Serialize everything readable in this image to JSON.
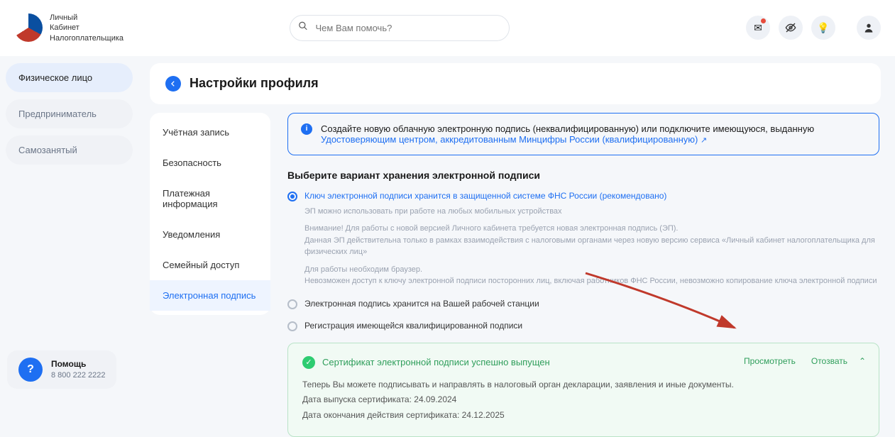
{
  "header": {
    "logo_line1": "Личный",
    "logo_line2": "Кабинет",
    "logo_line3": "Налогоплательщика",
    "search_placeholder": "Чем Вам помочь?"
  },
  "sidebar": {
    "items": [
      {
        "label": "Физическое лицо",
        "active": true
      },
      {
        "label": "Предприниматель",
        "active": false
      },
      {
        "label": "Самозанятый",
        "active": false
      }
    ]
  },
  "page": {
    "title": "Настройки профиля"
  },
  "settings_nav": {
    "items": [
      {
        "label": "Учётная запись"
      },
      {
        "label": "Безопасность"
      },
      {
        "label": "Платежная информация"
      },
      {
        "label": "Уведомления"
      },
      {
        "label": "Семейный доступ"
      },
      {
        "label": "Электронная подпись",
        "active": true
      }
    ]
  },
  "banner": {
    "text": "Создайте новую облачную электронную подпись (неквалифицированную) или подключите имеющуюся, выданную ",
    "link": "Удостоверяющим центром, аккредитованным Минцифры России (квалифицированную)"
  },
  "section": {
    "title": "Выберите вариант хранения электронной подписи",
    "opt1_label": "Ключ электронной подписи хранится в защищенной системе ФНС России (рекомендовано)",
    "opt1_sub1": "ЭП можно использовать при работе на любых мобильных устройствах",
    "opt1_sub2": "Внимание! Для работы с новой версией Личного кабинета требуется новая электронная подпись (ЭП).\nДанная ЭП действительна только в рамках взаимодействия с налоговыми органами через новую версию сервиса «Личный кабинет налогоплательщика для физических лиц»",
    "opt1_sub3": "Для работы необходим браузер.\nНевозможен доступ к ключу электронной подписи посторонних лиц, включая работников ФНС России, невозможно копирование ключа электронной подписи",
    "opt2_label": "Электронная подпись хранится на Вашей рабочей станции",
    "opt3_label": "Регистрация имеющейся квалифицированной подписи"
  },
  "cert": {
    "title": "Сертификат электронной подписи успешно выпущен",
    "desc": "Теперь Вы можете подписывать и направлять в налоговый орган декларации, заявления и иные документы.",
    "issued": "Дата выпуска сертификата: 24.09.2024",
    "expires": "Дата окончания действия сертификата: 24.12.2025",
    "view": "Просмотреть",
    "revoke": "Отозвать"
  },
  "help": {
    "title": "Помощь",
    "phone": "8 800 222 2222"
  }
}
